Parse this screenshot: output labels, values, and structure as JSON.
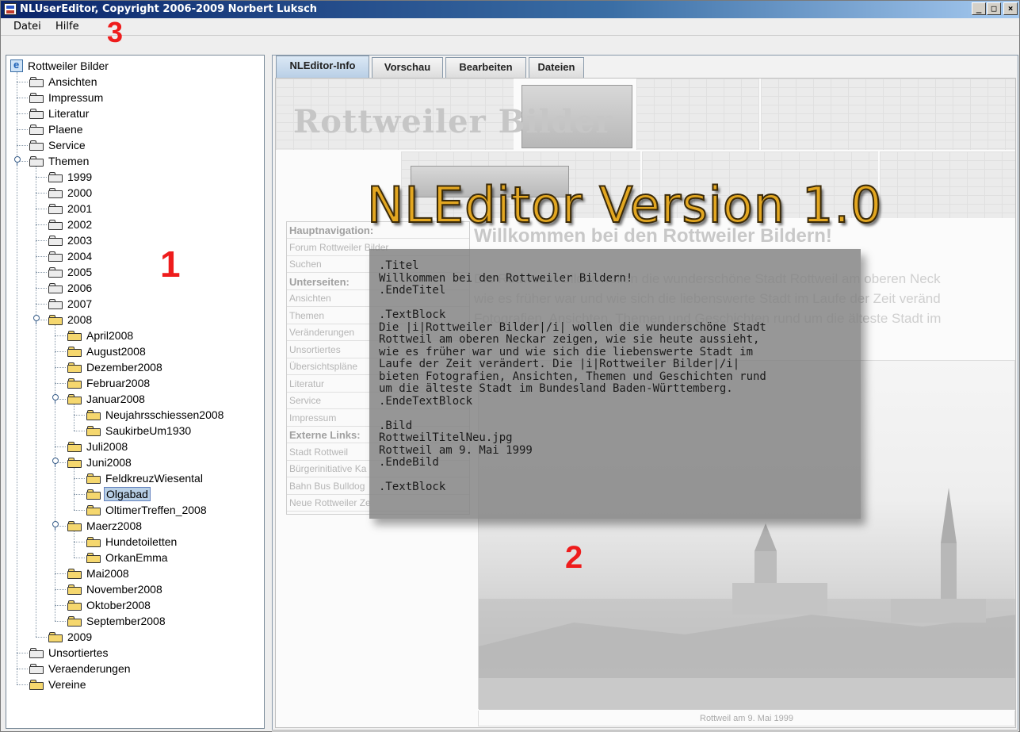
{
  "window": {
    "title": "NLUserEditor, Copyright 2006-2009 Norbert Luksch",
    "min_label": "_",
    "max_label": "□",
    "close_label": "×"
  },
  "menu": {
    "datei": "Datei",
    "hilfe": "Hilfe"
  },
  "annotations": {
    "n1": "1",
    "n2": "2",
    "n3": "3"
  },
  "tree": {
    "root": "Rottweiler Bilder",
    "items": [
      "Ansichten",
      "Impressum",
      "Literatur",
      "Plaene",
      "Service",
      "Themen",
      "1999",
      "2000",
      "2001",
      "2002",
      "2003",
      "2004",
      "2005",
      "2006",
      "2007",
      "2008",
      "April2008",
      "August2008",
      "Dezember2008",
      "Februar2008",
      "Januar2008",
      "Neujahrsschiessen2008",
      "SaukirbeUm1930",
      "Juli2008",
      "Juni2008",
      "FeldkreuzWiesental",
      "Olgabad",
      "OltimerTreffen_2008",
      "Maerz2008",
      "Hundetoiletten",
      "OrkanEmma",
      "Mai2008",
      "November2008",
      "Oktober2008",
      "September2008",
      "2009",
      "Unsortiertes",
      "Veraenderungen",
      "Vereine"
    ],
    "selected": "Olgabad"
  },
  "tabs": [
    "NLEditor-Info",
    "Vorschau",
    "Bearbeiten",
    "Dateien"
  ],
  "active_tab": "NLEditor-Info",
  "preview": {
    "site_title": "Rottweiler Bilder",
    "overlay_title": "NLEditor Version 1.0",
    "nav": [
      {
        "label": "Hauptnavigation:",
        "head": true
      },
      {
        "label": "Forum Rottweiler Bilder",
        "head": false
      },
      {
        "label": "Suchen",
        "head": false
      },
      {
        "label": "Unterseiten:",
        "head": true
      },
      {
        "label": "Ansichten",
        "head": false
      },
      {
        "label": "Themen",
        "head": false
      },
      {
        "label": "Veränderungen",
        "head": false
      },
      {
        "label": "Unsortiertes",
        "head": false
      },
      {
        "label": "Übersichtspläne",
        "head": false
      },
      {
        "label": "Literatur",
        "head": false
      },
      {
        "label": "Service",
        "head": false
      },
      {
        "label": "Impressum",
        "head": false
      },
      {
        "label": "Externe Links:",
        "head": true
      },
      {
        "label": "Stadt Rottweil",
        "head": false
      },
      {
        "label": "Bürgerinitiative Ka",
        "head": false
      },
      {
        "label": "Bahn Bus Bulldog",
        "head": false
      },
      {
        "label": "Neue Rottweiler Ze",
        "head": false
      }
    ],
    "welcome_heading": "Willkommen bei den Rottweiler Bildern!",
    "welcome_lines": [
      "Die Rottweiler Bilder wollen die wunderschöne Stadt Rottweil am oberen Neck",
      "wie es früher war und wie sich die liebenswerte Stadt im Laufe der Zeit veränd",
      "Fotografien, Ansichten, Themen und Geschichten rund um die älteste Stadt im"
    ],
    "photo_caption": "Rottweil am 9. Mai 1999",
    "code_lines": [
      ".Titel",
      "Willkommen bei den Rottweiler Bildern!",
      ".EndeTitel",
      "",
      ".TextBlock",
      "Die |i|Rottweiler Bilder|/i| wollen die wunderschöne Stadt",
      "Rottweil am oberen Neckar zeigen, wie sie heute aussieht,",
      "wie es früher war und wie sich die liebenswerte Stadt im",
      "Laufe der Zeit verändert. Die |i|Rottweiler Bilder|/i|",
      "bieten Fotografien, Ansichten, Themen und Geschichten rund",
      "um die älteste Stadt im Bundesland Baden-Württemberg.",
      ".EndeTextBlock",
      "",
      ".Bild",
      "RottweilTitelNeu.jpg",
      "Rottweil am 9. Mai 1999",
      ".EndeBild",
      "",
      ".TextBlock"
    ]
  }
}
